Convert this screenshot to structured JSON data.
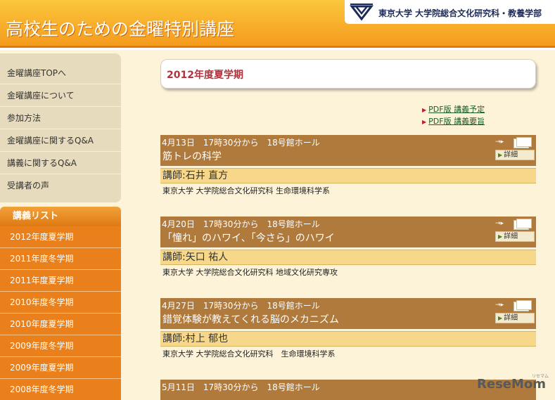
{
  "header": {
    "title": "高校生のための金曜特別講座",
    "university": "東京大学 大学院総合文化研究科・教養学部"
  },
  "sidebar": {
    "nav": [
      {
        "label": "金曜講座TOPへ"
      },
      {
        "label": "金曜講座について"
      },
      {
        "label": "参加方法"
      },
      {
        "label": "金曜講座に関するQ&A"
      },
      {
        "label": "講義に関するQ&A"
      },
      {
        "label": "受講者の声"
      }
    ],
    "lecture_list_title": "講義リスト",
    "lecture_list": [
      {
        "label": "2012年度夏学期"
      },
      {
        "label": "2011年度冬学期"
      },
      {
        "label": "2011年度夏学期"
      },
      {
        "label": "2010年度冬学期"
      },
      {
        "label": "2010年度夏学期"
      },
      {
        "label": "2009年度冬学期"
      },
      {
        "label": "2009年度夏学期"
      },
      {
        "label": "2008年度冬学期"
      }
    ]
  },
  "main": {
    "term_title": "2012年度夏学期",
    "pdf_links": [
      {
        "label": "PDF版 講義予定"
      },
      {
        "label": "PDF版 講義要旨"
      }
    ],
    "detail_label": "詳細",
    "lectures": [
      {
        "date": "4月13日　17時30分から　18号館ホール",
        "title": "筋トレの科学",
        "instructor": "講師:石井 直方",
        "affiliation": "東京大学 大学院総合文化研究科 生命環境科学系"
      },
      {
        "date": "4月20日　17時30分から　18号館ホール",
        "title": "「憧れ」のハワイ、「今さら」のハワイ",
        "instructor": "講師:矢口 祐人",
        "affiliation": "東京大学 大学院総合文化研究科 地域文化研究専攻"
      },
      {
        "date": "4月27日　17時30分から　18号館ホール",
        "title": "錯覚体験が教えてくれる脳のメカニズム",
        "instructor": "講師:村上 郁也",
        "affiliation": "東京大学 大学院総合文化研究科　生命環境科学系"
      },
      {
        "date": "5月11日　17時30分から　18号館ホール",
        "title": "",
        "instructor": "",
        "affiliation": ""
      }
    ]
  },
  "watermark": {
    "text": "ReseMom",
    "small": "リセマム"
  },
  "colors": {
    "header_orange": "#f59b1e",
    "lecture_bar": "#b07a3c",
    "instructor_bg": "#f7d789",
    "term_title": "#b3303c",
    "side_list": "#e9801b"
  }
}
